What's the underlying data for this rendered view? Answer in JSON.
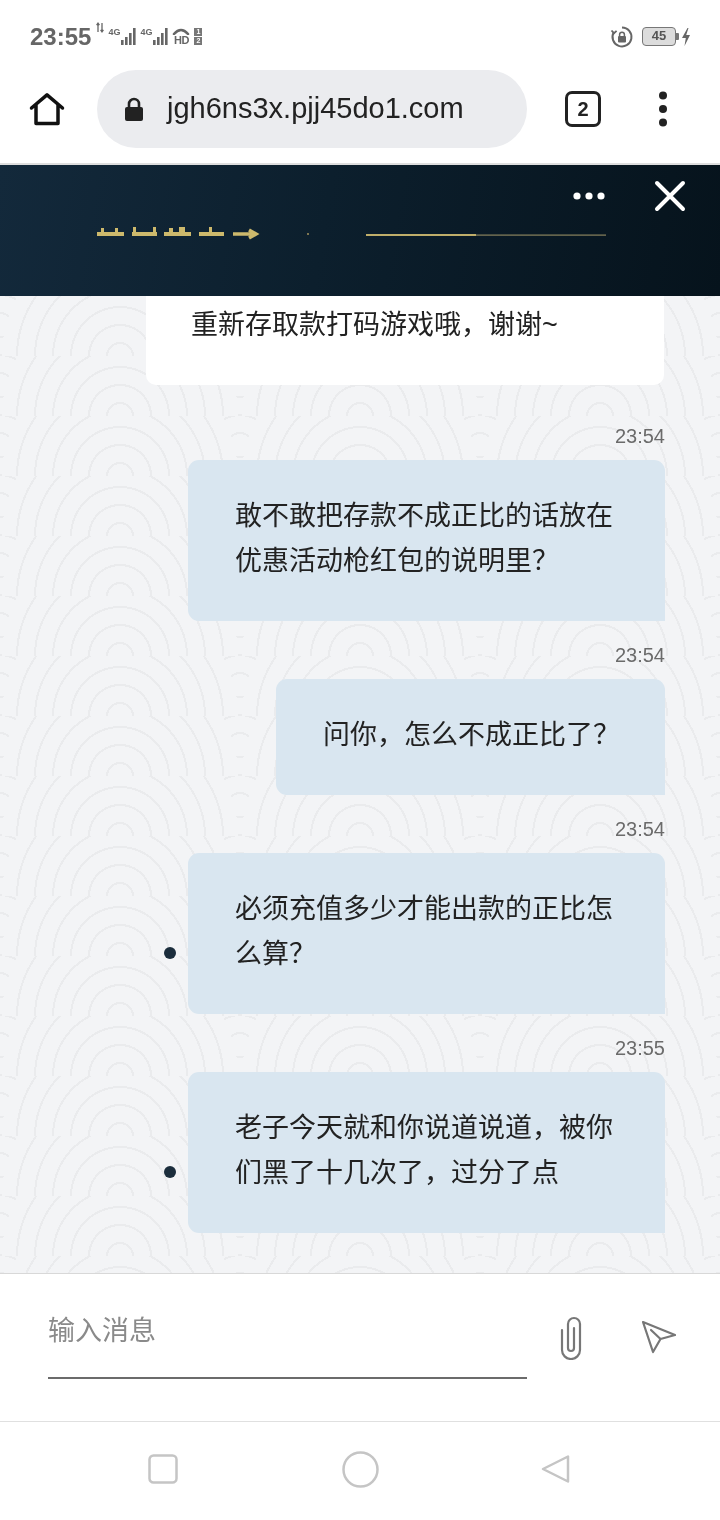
{
  "status_bar": {
    "time": "23:55",
    "networks": [
      {
        "label": "4G"
      },
      {
        "label": "4G"
      }
    ],
    "hd": {
      "label": "HD",
      "sims": [
        "1",
        "2"
      ]
    },
    "battery": "45"
  },
  "browser": {
    "url": "jgh6ns3x.pjj45do1.com",
    "tab_count": "2"
  },
  "messages": [
    {
      "kind": "received",
      "text": "重新存取款打码游戏哦，谢谢~",
      "dot": false
    },
    {
      "kind": "sent",
      "time": "23:54",
      "text": "敢不敢把存款不成正比的话放在优惠活动枪红包的说明里？",
      "dot": false
    },
    {
      "kind": "sent",
      "time": "23:54",
      "text": "问你，怎么不成正比了？",
      "dot": false
    },
    {
      "kind": "sent",
      "time": "23:54",
      "text": "必须充值多少才能出款的正比怎么算？",
      "dot": true
    },
    {
      "kind": "sent",
      "time": "23:55",
      "text": "老子今天就和你说道说道，被你们黑了十几次了，过分了点",
      "dot": true
    }
  ],
  "composer": {
    "placeholder": "输入消息"
  }
}
